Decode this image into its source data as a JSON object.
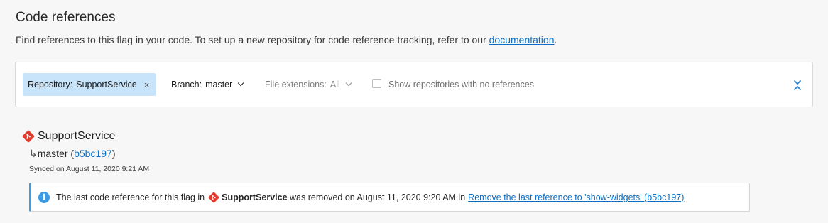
{
  "section": {
    "title": "Code references",
    "description_prefix": "Find references to this flag in your code. To set up a new repository for code reference tracking, refer to our ",
    "doc_link": "documentation",
    "description_suffix": "."
  },
  "filters": {
    "repository_label": "Repository:",
    "repository_value": "SupportService",
    "remove_glyph": "×",
    "branch_label": "Branch:",
    "branch_value": "master",
    "extensions_label": "File extensions:",
    "extensions_value": "All",
    "show_empty_label": "Show repositories with no references",
    "show_empty_checked": false
  },
  "repo": {
    "name": "SupportService",
    "branch_arrow": "↳",
    "branch": "master",
    "commit_open": "(",
    "commit": "b5bc197",
    "commit_close": ")",
    "synced": "Synced on August 11, 2020 9:21 AM",
    "icon": "git-icon"
  },
  "notice": {
    "icon": "info-icon",
    "text_before": "The last code reference for this flag in",
    "repo": "SupportService",
    "text_after": "was removed on August 11, 2020 9:20 AM in",
    "link": "Remove the last reference to 'show-widgets' (b5bc197)"
  },
  "colors": {
    "accent": "#0b6ec4",
    "chip_bg": "#c8e4fb",
    "info": "#3d9be3",
    "git": "#e23b2e"
  }
}
